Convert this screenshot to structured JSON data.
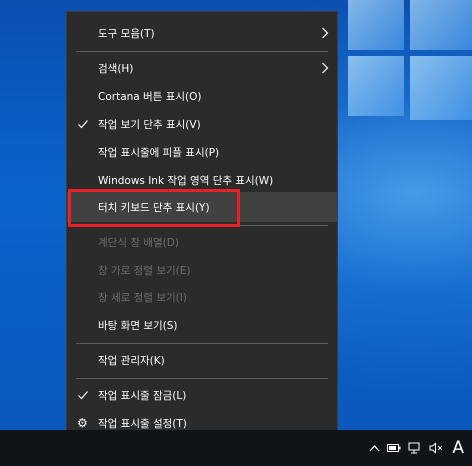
{
  "menu": {
    "items": [
      {
        "label": "도구 모음(T)",
        "submenu": true
      },
      {
        "label": "검색(H)",
        "submenu": true
      },
      {
        "label": "Cortana 버튼 표시(O)"
      },
      {
        "label": "작업 보기 단추 표시(V)",
        "checked": true
      },
      {
        "label": "작업 표시줄에 피플 표시(P)"
      },
      {
        "label": "Windows Ink 작업 영역 단추 표시(W)"
      },
      {
        "label": "터치 키보드 단추 표시(Y)",
        "highlighted": true
      },
      {
        "label": "계단식 창 배열(D)",
        "disabled": true
      },
      {
        "label": "창 가로 정렬 보기(E)",
        "disabled": true
      },
      {
        "label": "창 세로 정렬 보기(I)",
        "disabled": true
      },
      {
        "label": "바탕 화면 보기(S)"
      },
      {
        "label": "작업 관리자(K)"
      },
      {
        "label": "작업 표시줄 잠금(L)",
        "checked": true
      },
      {
        "label": "작업 표시줄 설정(T)",
        "icon": "gear-icon"
      }
    ]
  },
  "tray": {
    "ime_indicator": "A",
    "icons": [
      "chevron-up-icon",
      "battery-icon",
      "network-icon",
      "volume-muted-icon"
    ]
  },
  "colors": {
    "menu_bg": "#2b2b2b",
    "highlight_border": "#e8202a",
    "disabled_text": "#6d6d6d",
    "taskbar_bg": "#101418"
  }
}
